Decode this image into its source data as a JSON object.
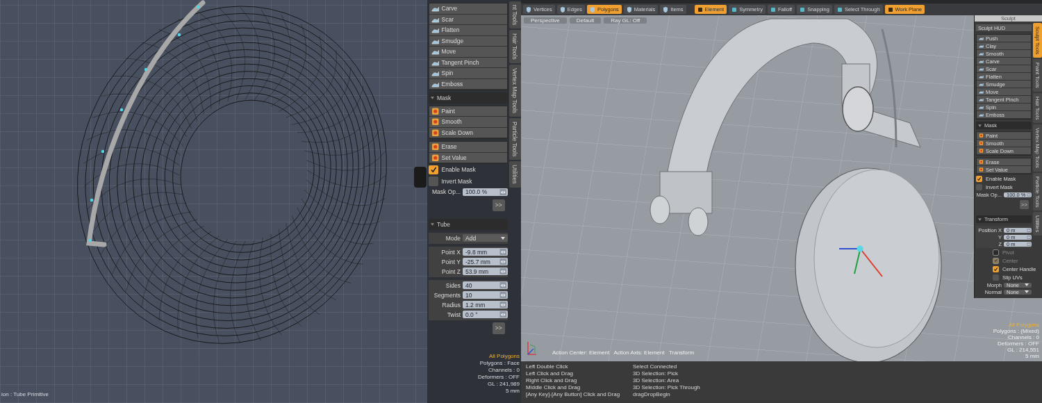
{
  "left_viewport": {
    "status": "ion : Tube Primitive"
  },
  "left_panel": {
    "tools": [
      "Carve",
      "Scar",
      "Flatten",
      "Smudge",
      "Move",
      "Tangent Pinch",
      "Spin",
      "Emboss"
    ],
    "mask_title": "Mask",
    "mask_tools": [
      "Paint",
      "Smooth",
      "Scale Down"
    ],
    "mask_edit_tools": [
      "Erase",
      "Set Value"
    ],
    "toggles": [
      {
        "label": "Enable Mask",
        "checked": true
      },
      {
        "label": "Invert Mask",
        "checked": false
      }
    ],
    "mask_opacity": {
      "label": "Mask Op...",
      "value": "100.0 %"
    },
    "more_button": ">>",
    "tube": {
      "title": "Tube",
      "mode": {
        "label": "Mode",
        "value": "Add"
      },
      "points": [
        {
          "label": "Point X",
          "value": "-9.8 mm"
        },
        {
          "label": "Point Y",
          "value": "-25.7 mm"
        },
        {
          "label": "Point Z",
          "value": "53.9 mm"
        }
      ],
      "params": [
        {
          "label": "Sides",
          "value": "40"
        },
        {
          "label": "Segments",
          "value": "10"
        },
        {
          "label": "Radius",
          "value": "1.2 mm"
        },
        {
          "label": "Twist",
          "value": "0.0 °"
        }
      ],
      "more_button": ">>"
    },
    "side_tabs": [
      {
        "label": "nt Tools",
        "selected": false
      },
      {
        "label": "Hair Tools",
        "selected": false
      },
      {
        "label": "Vertex Map Tools",
        "selected": false
      },
      {
        "label": "Particle Tools",
        "selected": false
      },
      {
        "label": "Utilities",
        "selected": false
      }
    ]
  },
  "left_info": [
    "All Polygons",
    "Polygons : Face",
    "Channels : 0",
    "Deformers : OFF",
    "GL : 241,989",
    "5 mm"
  ],
  "toolbar": {
    "selection_modes": [
      {
        "label": "Vertices",
        "selected": false
      },
      {
        "label": "Edges",
        "selected": false
      },
      {
        "label": "Polygons",
        "selected": true
      },
      {
        "label": "Materials",
        "selected": false
      },
      {
        "label": "Items",
        "selected": false
      }
    ],
    "tools": [
      {
        "label": "Element",
        "selected": true
      },
      {
        "label": "Symmetry",
        "selected": false
      },
      {
        "label": "Falloff",
        "selected": false
      },
      {
        "label": "Snapping",
        "selected": false
      },
      {
        "label": "Select Through",
        "selected": false
      },
      {
        "label": "Work Plane",
        "selected": true
      }
    ]
  },
  "viewport": {
    "tabs": [
      "Perspective",
      "Default",
      "Ray GL: Off"
    ],
    "action_status": "Action Center: Element   Action Axis: Element   Transform",
    "info": [
      "All Polygons",
      "Polygons : (Mixed)",
      "Channels : 0",
      "Deformers : OFF",
      "GL : 214,551",
      "5 mm"
    ]
  },
  "sculpt_panel": {
    "title": "Sculpt",
    "hud_button": "Sculpt HUD",
    "tools": [
      "Push",
      "Clay",
      "Smooth",
      "Carve",
      "Scar",
      "Flatten",
      "Smudge",
      "Move",
      "Tangent Pinch",
      "Spin",
      "Emboss"
    ],
    "mask_title": "Mask",
    "mask_tools": [
      "Paint",
      "Smooth",
      "Scale Down"
    ],
    "mask_edit_tools": [
      "Erase",
      "Set Value"
    ],
    "toggles": [
      {
        "label": "Enable Mask",
        "checked": true
      },
      {
        "label": "Invert Mask",
        "checked": false
      }
    ],
    "mask_opacity": {
      "label": "Mask Op...",
      "value": "100.0 %"
    },
    "more_button": ">>",
    "transform": {
      "title": "Transform",
      "position": [
        {
          "label": "Position X",
          "value": "0 m"
        },
        {
          "label": "Y",
          "value": "0 m"
        },
        {
          "label": "Z",
          "value": "0 m"
        }
      ],
      "options": [
        {
          "label": "Pivot",
          "checked": false,
          "disabled": true
        },
        {
          "label": "Center",
          "checked": true,
          "disabled": true
        },
        {
          "label": "Center Handle",
          "checked": true,
          "disabled": false
        },
        {
          "label": "Slip UVs",
          "checked": false,
          "disabled": false
        }
      ],
      "dropdowns": [
        {
          "label": "Morph",
          "value": "None"
        },
        {
          "label": "Normal",
          "value": "None"
        }
      ]
    },
    "side_tabs": [
      {
        "label": "Sculpt Tools",
        "selected": true
      },
      {
        "label": "Paint Tools",
        "selected": false
      },
      {
        "label": "Hair Tools",
        "selected": false
      },
      {
        "label": "Vertex Map Tools",
        "selected": false
      },
      {
        "label": "Particle Tools",
        "selected": false
      },
      {
        "label": "Utilities",
        "selected": false
      }
    ]
  },
  "status_bar": {
    "hints": [
      {
        "input": "Left Double Click",
        "action": "Select Connected"
      },
      {
        "input": "Left Click and Drag",
        "action": "3D Selection: Pick"
      },
      {
        "input": "Right Click and Drag",
        "action": "3D Selection: Area"
      },
      {
        "input": "Middle Click and Drag",
        "action": "3D Selection: Pick Through"
      },
      {
        "input": "[Any Key]-[Any Button] Click and Drag",
        "action": "dragDropBegin"
      }
    ]
  }
}
